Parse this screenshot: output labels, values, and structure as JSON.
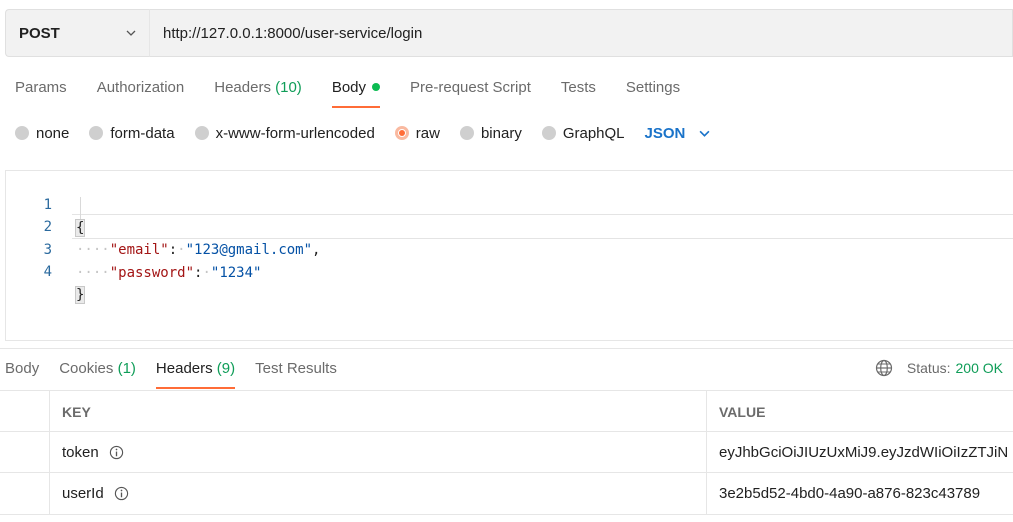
{
  "request": {
    "method": "POST",
    "url": "http://127.0.0.1:8000/user-service/login"
  },
  "request_tabs": [
    {
      "label": "Params",
      "count": ""
    },
    {
      "label": "Authorization",
      "count": ""
    },
    {
      "label": "Headers",
      "count": "(10)"
    },
    {
      "label": "Body",
      "count": ""
    },
    {
      "label": "Pre-request Script",
      "count": ""
    },
    {
      "label": "Tests",
      "count": ""
    },
    {
      "label": "Settings",
      "count": ""
    }
  ],
  "body_types": {
    "none": "none",
    "form_data": "form-data",
    "urlencoded": "x-www-form-urlencoded",
    "raw": "raw",
    "binary": "binary",
    "graphql": "GraphQL",
    "format": "JSON"
  },
  "editor": {
    "line_numbers": [
      "1",
      "2",
      "3",
      "4"
    ],
    "open_brace": "{",
    "close_brace": "}",
    "line2_key": "\"email\"",
    "line2_value": "\"123@gmail.com\"",
    "line3_key": "\"password\"",
    "line3_value": "\"1234\""
  },
  "response_tabs": [
    {
      "label": "Body",
      "count": ""
    },
    {
      "label": "Cookies",
      "count": "(1)"
    },
    {
      "label": "Headers",
      "count": "(9)"
    },
    {
      "label": "Test Results",
      "count": ""
    }
  ],
  "status": {
    "label": "Status:",
    "value": "200 OK"
  },
  "headers_table": {
    "columns": [
      "KEY",
      "VALUE"
    ],
    "rows": [
      {
        "key": "token",
        "value": "eyJhbGciOiJIUzUxMiJ9.eyJzdWIiOiIzZTJiN"
      },
      {
        "key": "userId",
        "value": "3e2b5d52-4bd0-4a90-a876-823c43789"
      }
    ]
  },
  "colors": {
    "accent": "#ff6c37",
    "success": "#0f9d58",
    "link": "#1a73c9"
  }
}
